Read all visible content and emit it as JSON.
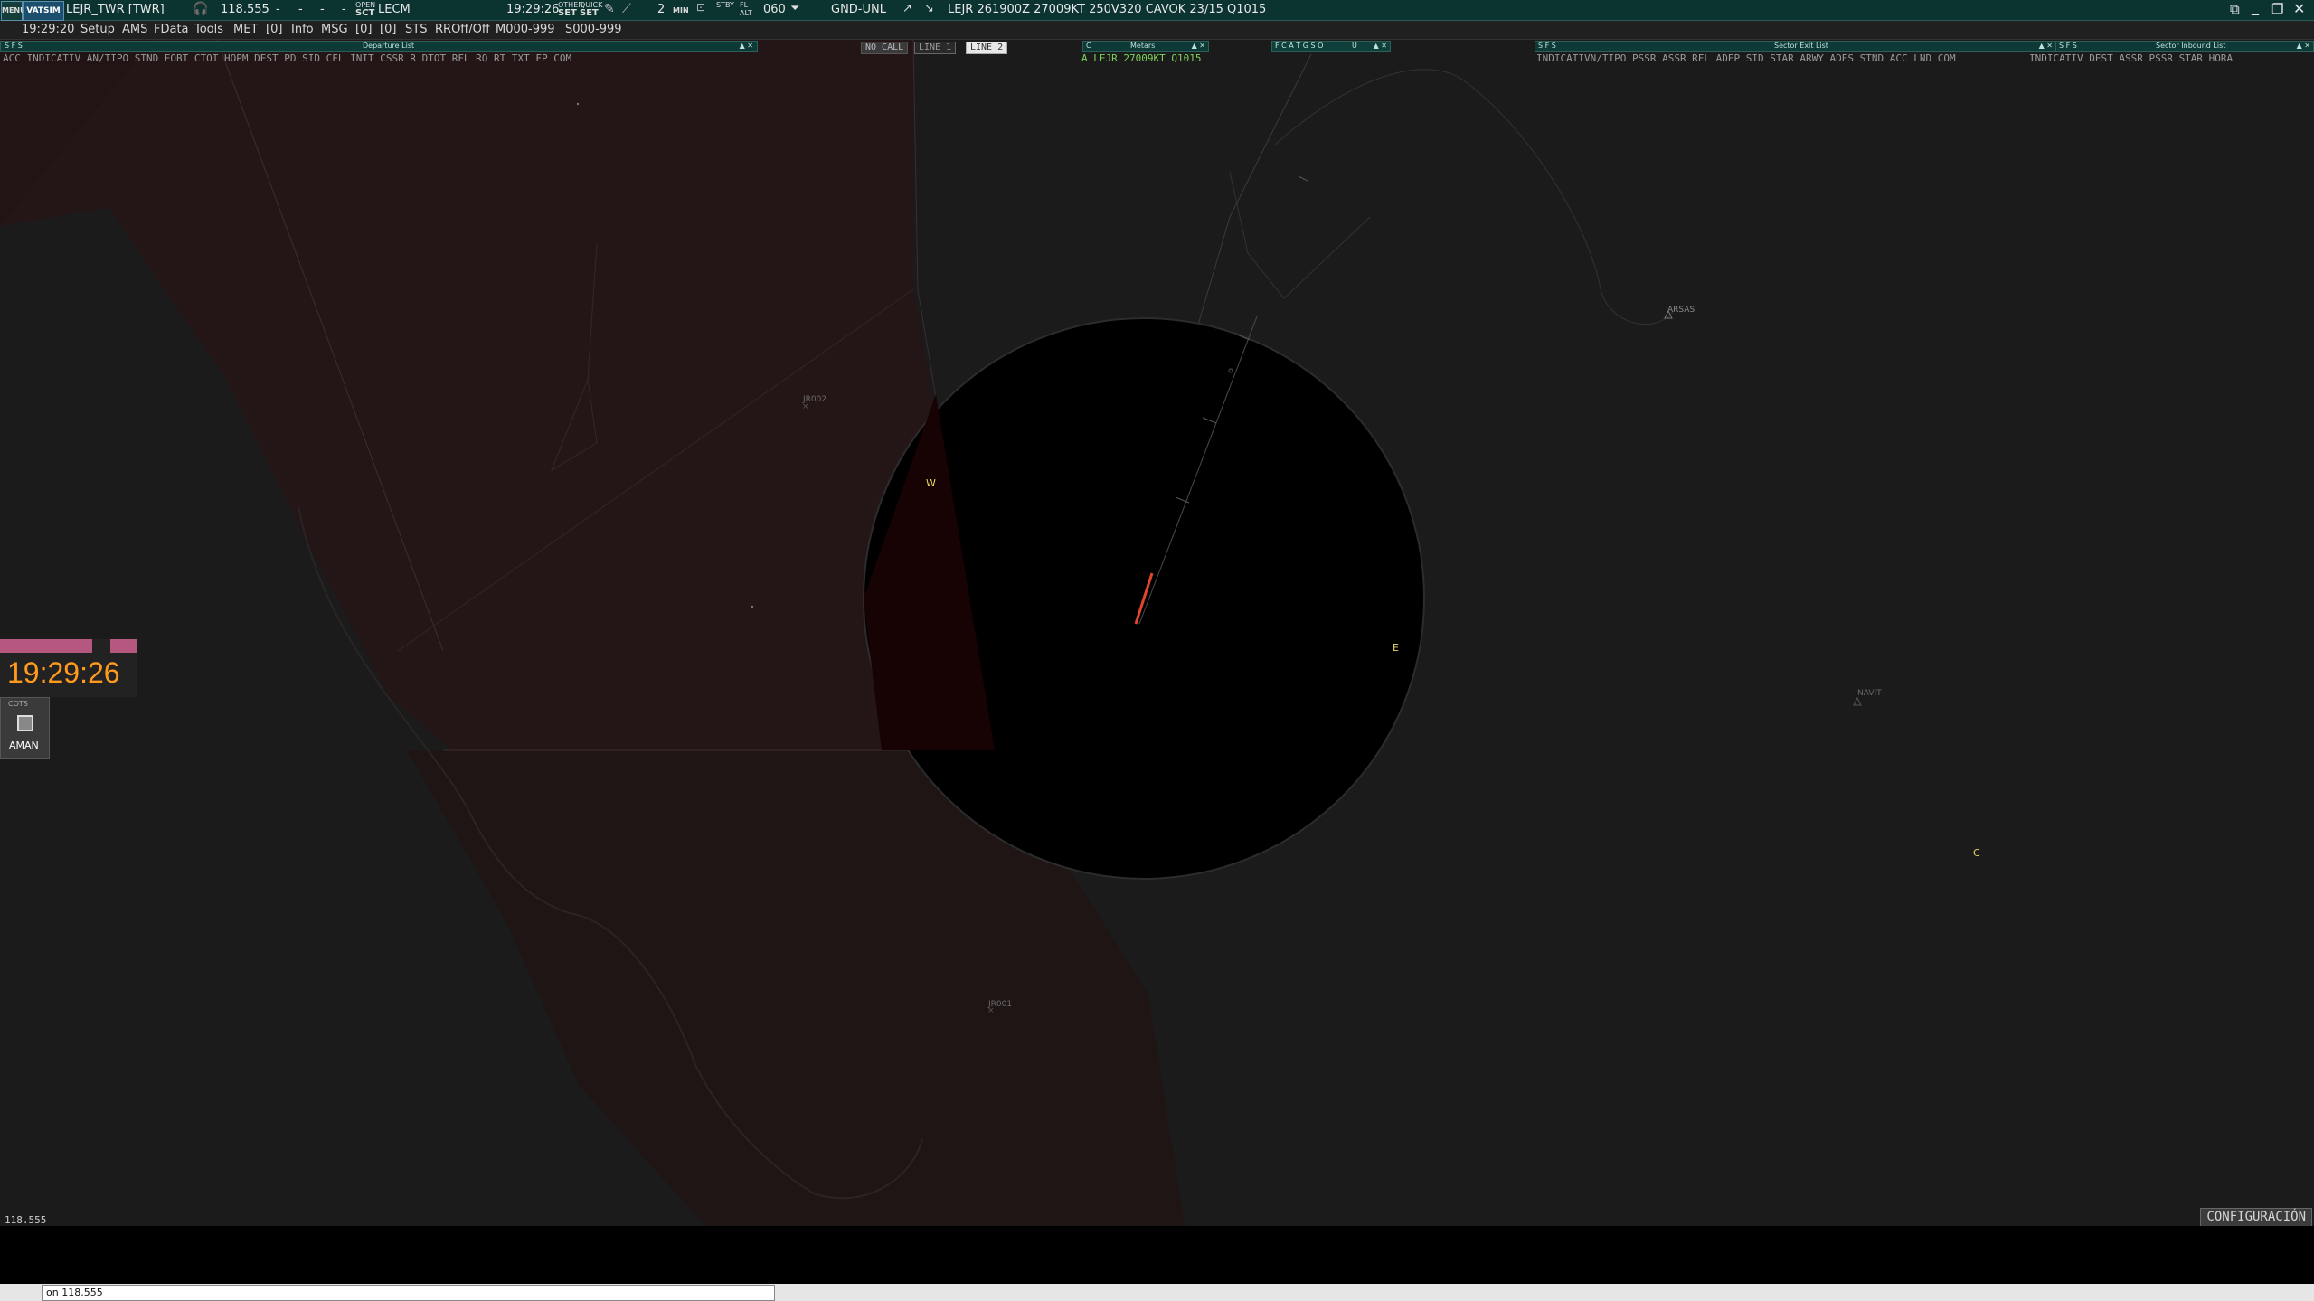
{
  "topbar": {
    "menu_label": "MENU",
    "vatsim_label": "VATSIM",
    "position": "LEJR_TWR [TWR]",
    "frequency": "118.555",
    "dashes": [
      "-",
      "-",
      "-",
      "-"
    ],
    "open_label": "OPEN",
    "sct_label": "SCT",
    "sector": "LECM",
    "time": "19:29:26",
    "other_label": "OTHER",
    "quick_label": "QUICK",
    "set1": "SET",
    "set2": "SET",
    "min_count": "2",
    "min_label": "MIN",
    "stby_label": "STBY",
    "fl_label": "FL",
    "alt_label": "ALT",
    "heading": "060",
    "level_filter": "GND-UNL",
    "metar": "LEJR 261900Z 27009KT 250V320 CAVOK 23/15 Q1015"
  },
  "menubar": {
    "time": "19:29:20",
    "items": [
      "Setup",
      "AMS",
      "FData",
      "Tools",
      "MET",
      "[0]",
      "Info",
      "MSG",
      "[0]",
      "[0]",
      "STS",
      "RROff/Off",
      "M000-999",
      "S000-999"
    ]
  },
  "departure_list": {
    "title": "Departure List",
    "filters": "S F S",
    "columns": "ACC    INDICATIV  AN/TIPO STND  EOBT  CTOT  HOPM  DEST   PD    SID    CFL  INIT  CSSR  R  DTOT  RFL  RQ  RT        TXT       FP COM"
  },
  "call_tabs": {
    "no_call": "NO CALL",
    "line1": "LINE 1",
    "line2": "LINE 2"
  },
  "metars_window": {
    "title": "Metars",
    "marker": "C",
    "entry": "A LEJR 27009KT Q1015"
  },
  "flags_window": {
    "letters": "F C A T G S O",
    "u_label": "U"
  },
  "sector_exit_list": {
    "title": "Sector Exit List",
    "filters": "S F S",
    "columns": "INDICATIVN/TIPO PSSR  ASSR  RFL  ADEP   SID     STAR   ARWY ADES  STND   ACC   LND COM"
  },
  "sector_inbound_list": {
    "title": "Sector Inbound List",
    "filters": "S F S",
    "columns": "INDICATIV  DEST   ASSR  PSSR   STAR    HORA"
  },
  "map_labels": {
    "w": "W",
    "e": "E",
    "c": "C",
    "fix_arsas": "ARSAS",
    "fix_navit": "NAVIT",
    "fix_jr002": "JR002",
    "fix_jr001": "JR001"
  },
  "left_panel": {
    "clock": "19:29:26",
    "cots_label": "COTS",
    "aman_label": "AMAN",
    "freq_readout": "118.555"
  },
  "config_button": "CONFIGURACIÓN",
  "command_line": {
    "value": "on 118.555"
  },
  "colors": {
    "topbar": "#0b3330",
    "clock": "#ff9a1e",
    "bars": "#b6577f",
    "metar_green": "#7fd35a",
    "runway": "#e0452e"
  }
}
